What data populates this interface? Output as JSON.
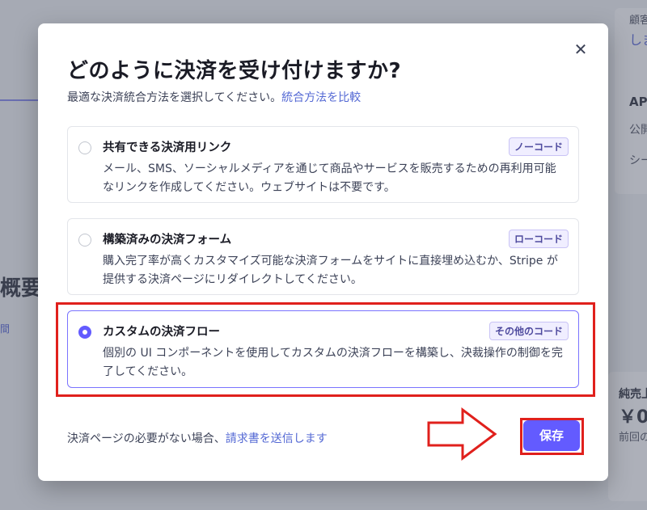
{
  "background": {
    "right_top_label": "顧客",
    "right_top_link": "しま",
    "right_api": "APIキー",
    "right_public": "公開",
    "right_secret": "シー",
    "left_heading": "概要",
    "left_chip": "間",
    "right_sales": "純売上",
    "right_amount": "￥0",
    "right_prev": "前回の"
  },
  "modal": {
    "title": "どのように決済を受け付けますか?",
    "subtitle": "最適な決済統合方法を選択してください。",
    "subtitle_link": "統合方法を比較",
    "close_symbol": "✕",
    "options": [
      {
        "title": "共有できる決済用リンク",
        "badge": "ノーコード",
        "description": "メール、SMS、ソーシャルメディアを通じて商品やサービスを販売するための再利用可能なリンクを作成してください。ウェブサイトは不要です。",
        "selected": false
      },
      {
        "title": "構築済みの決済フォーム",
        "badge": "ローコード",
        "description": "購入完了率が高くカスタマイズ可能な決済フォームをサイトに直接埋め込むか、Stripe が提供する決済ページにリダイレクトしてください。",
        "selected": false
      },
      {
        "title": "カスタムの決済フロー",
        "badge": "その他のコード",
        "description": "個別の UI コンポーネントを使用してカスタムの決済フローを構築し、決裁操作の制御を完了してください。",
        "selected": true
      }
    ],
    "footer_text": "決済ページの必要がない場合、",
    "footer_link": "請求書を送信します",
    "save_label": "保存"
  },
  "colors": {
    "accent": "#635bff",
    "link": "#5469d4",
    "annotation_red": "#e0201c"
  }
}
